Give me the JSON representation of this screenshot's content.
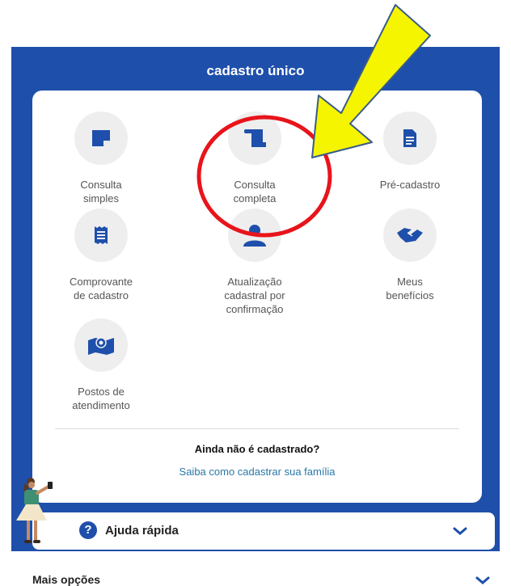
{
  "header": {
    "title": "cadastro único"
  },
  "tiles": [
    {
      "label": "Consulta\nsimples",
      "icon": "note-icon"
    },
    {
      "label": "Consulta\ncompleta",
      "icon": "scroll-icon"
    },
    {
      "label": "Pré-cadastro",
      "icon": "document-icon"
    },
    {
      "label": "Comprovante\nde cadastro",
      "icon": "receipt-icon"
    },
    {
      "label": "Atualização\ncadastral por\nconfirmação",
      "icon": "person-icon"
    },
    {
      "label": "Meus\nbenefícios",
      "icon": "handshake-icon"
    },
    {
      "label": "Postos de\natendimento",
      "icon": "map-pin-icon"
    }
  ],
  "register": {
    "question": "Ainda não é cadastrado?",
    "link": "Saiba como cadastrar sua família"
  },
  "help": {
    "label": "Ajuda rápida"
  },
  "more": {
    "label": "Mais opções"
  },
  "colors": {
    "brand": "#1e4fab",
    "annotation_arrow": "#f6f500",
    "annotation_circle": "#e8141b",
    "link": "#2a78a7"
  }
}
